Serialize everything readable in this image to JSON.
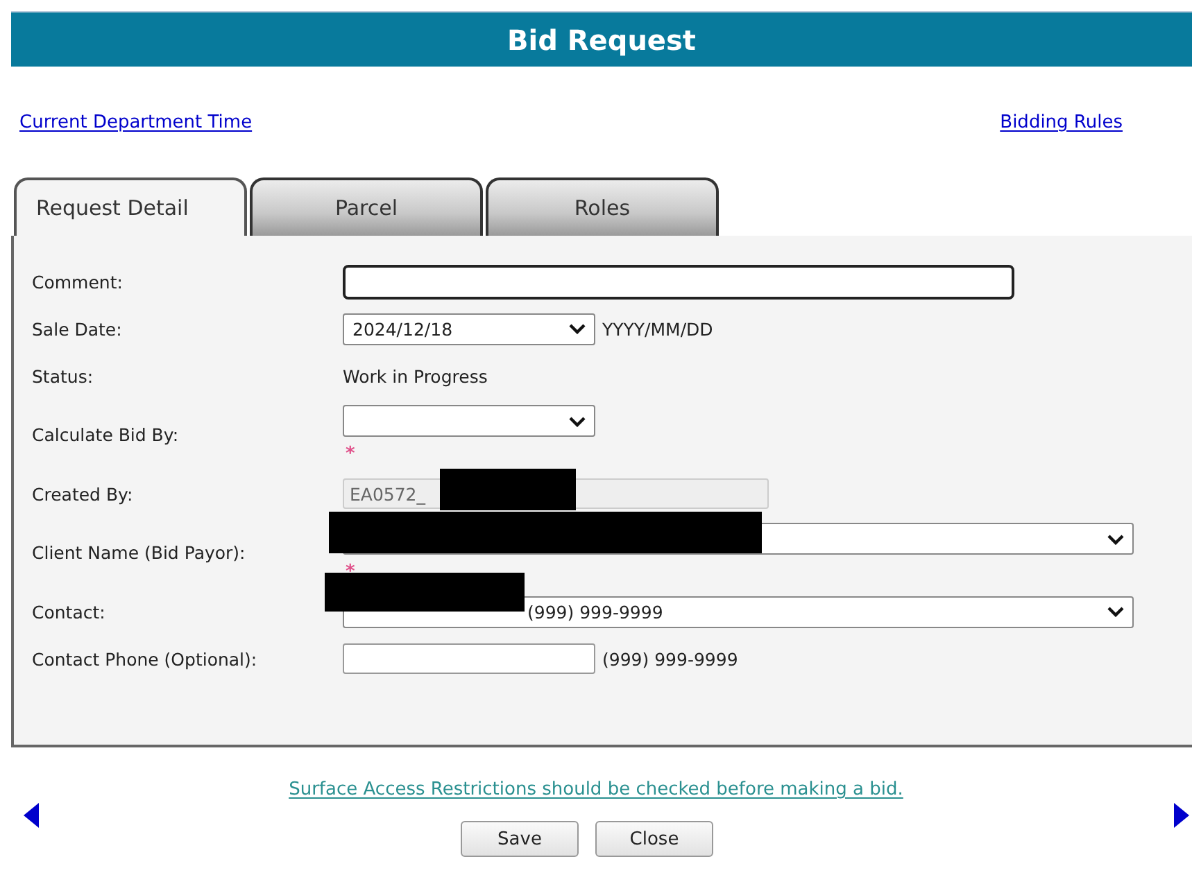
{
  "header": {
    "title": "Bid Request"
  },
  "links": [
    {
      "label": "Current Department Time"
    },
    {
      "label": "Bidding Rules"
    }
  ],
  "tabs": [
    {
      "label": "Request Detail",
      "selected": true
    },
    {
      "label": "Parcel",
      "selected": false
    },
    {
      "label": "Roles",
      "selected": false
    }
  ],
  "fields": [
    {
      "kind": "text",
      "label": "Comment:",
      "focused": true
    },
    {
      "kind": "select",
      "label": "Sale Date:",
      "value": "2024/12/18",
      "hint": "YYYY/MM/DD"
    },
    {
      "kind": "static",
      "label": "Status:",
      "value": "Work in Progress"
    },
    {
      "kind": "select",
      "label": "Calculate Bid By:",
      "marker": "*"
    },
    {
      "kind": "readonly",
      "label": "Created By:",
      "value": "EA0572_",
      "redacted": true
    },
    {
      "kind": "select",
      "label": "Client Name (Bid Payor):",
      "marker": "*",
      "redacted": true
    },
    {
      "kind": "select",
      "label": "Contact:",
      "value": "(999) 999-9999",
      "redacted": true
    },
    {
      "kind": "text",
      "label": "Contact Phone (Optional):",
      "hint": "(999) 999-9999",
      "focused": false
    }
  ],
  "notice": "Surface Access Restrictions should be checked before making a bid.",
  "buttons": [
    "Save",
    "Close"
  ]
}
